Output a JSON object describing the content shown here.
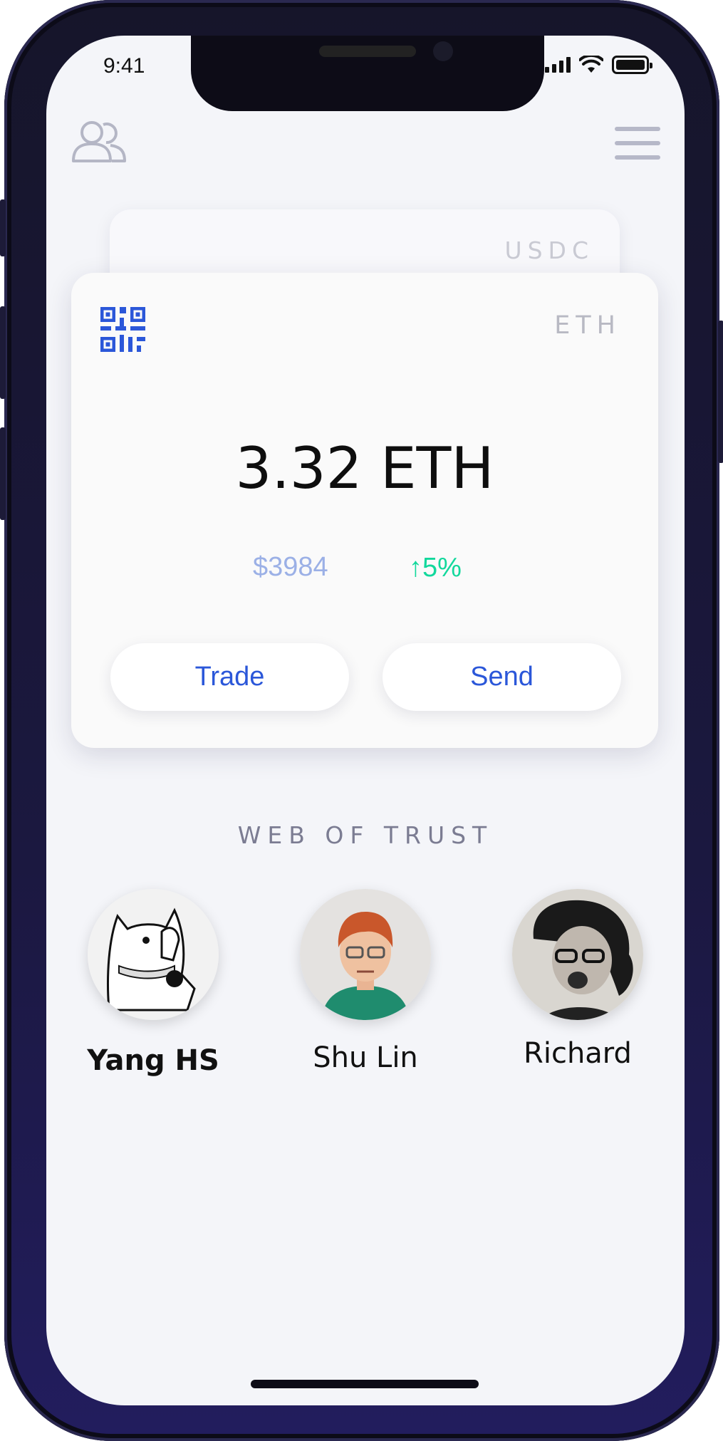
{
  "status_bar": {
    "time": "9:41"
  },
  "header": {
    "contacts_icon": "users-icon",
    "menu_icon": "hamburger-menu-icon"
  },
  "cards": {
    "back": {
      "token": "USDC"
    },
    "front": {
      "token": "ETH",
      "qr_icon": "qr-code-icon",
      "balance": "3.32 ETH",
      "fiat_value": "$3984",
      "change": "↑5%",
      "change_color": "#12d89c",
      "fiat_color": "#9bb0e6",
      "trade_label": "Trade",
      "send_label": "Send",
      "button_text_color": "#2b57d9"
    }
  },
  "web_of_trust": {
    "title": "WEB OF TRUST",
    "people": [
      {
        "name": "Yang HS"
      },
      {
        "name": "Shu Lin"
      },
      {
        "name": "Richard"
      }
    ]
  }
}
